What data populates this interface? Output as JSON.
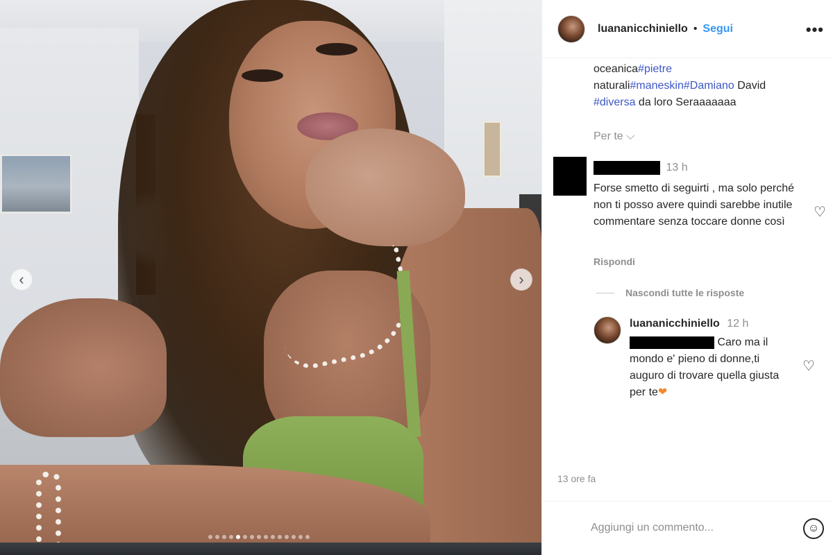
{
  "post": {
    "username": "luananicchiniello",
    "separator": "•",
    "follow_label": "Segui",
    "more_label": "•••",
    "carousel": {
      "prev_label": "‹",
      "next_label": "›",
      "dot_count": 15,
      "active_index": 4
    }
  },
  "caption": {
    "parts": [
      {
        "text": "oceanica",
        "tag": false
      },
      {
        "text": "#pietre",
        "tag": true
      },
      {
        "text": " naturali",
        "tag": false
      },
      {
        "text": "#maneskin",
        "tag": true
      },
      {
        "text": "#Damiano",
        "tag": true
      },
      {
        "text": " David ",
        "tag": false
      },
      {
        "text": "#diversa",
        "tag": true
      },
      {
        "text": " da loro Seraaaaaaa",
        "tag": false
      }
    ]
  },
  "translate_label": "Per te ⌵",
  "comment": {
    "time": "13 h",
    "text": "Forse smetto di seguirti , ma solo perché non ti posso avere quindi sarebbe inutile commentare senza toccare donne così",
    "reply_label": "Rispondi",
    "like_icon": "♡"
  },
  "hide_replies_label": "Nascondi tutte le risposte",
  "reply": {
    "username": "luananicchiniello",
    "time": "12 h",
    "text_before": " Caro ma il mondo e' pieno di donne,ti auguro di trovare quella giusta per te",
    "emoji": "❤",
    "like_icon": "♡"
  },
  "timestamp": "13 ore fa",
  "add_comment": {
    "placeholder": "Aggiungi un commento...",
    "emoji_icon": "☺"
  },
  "colors": {
    "link": "#3897f0",
    "hashtag": "#3c57c6",
    "muted": "#8e8e8e",
    "heart": "#f28a2b"
  }
}
